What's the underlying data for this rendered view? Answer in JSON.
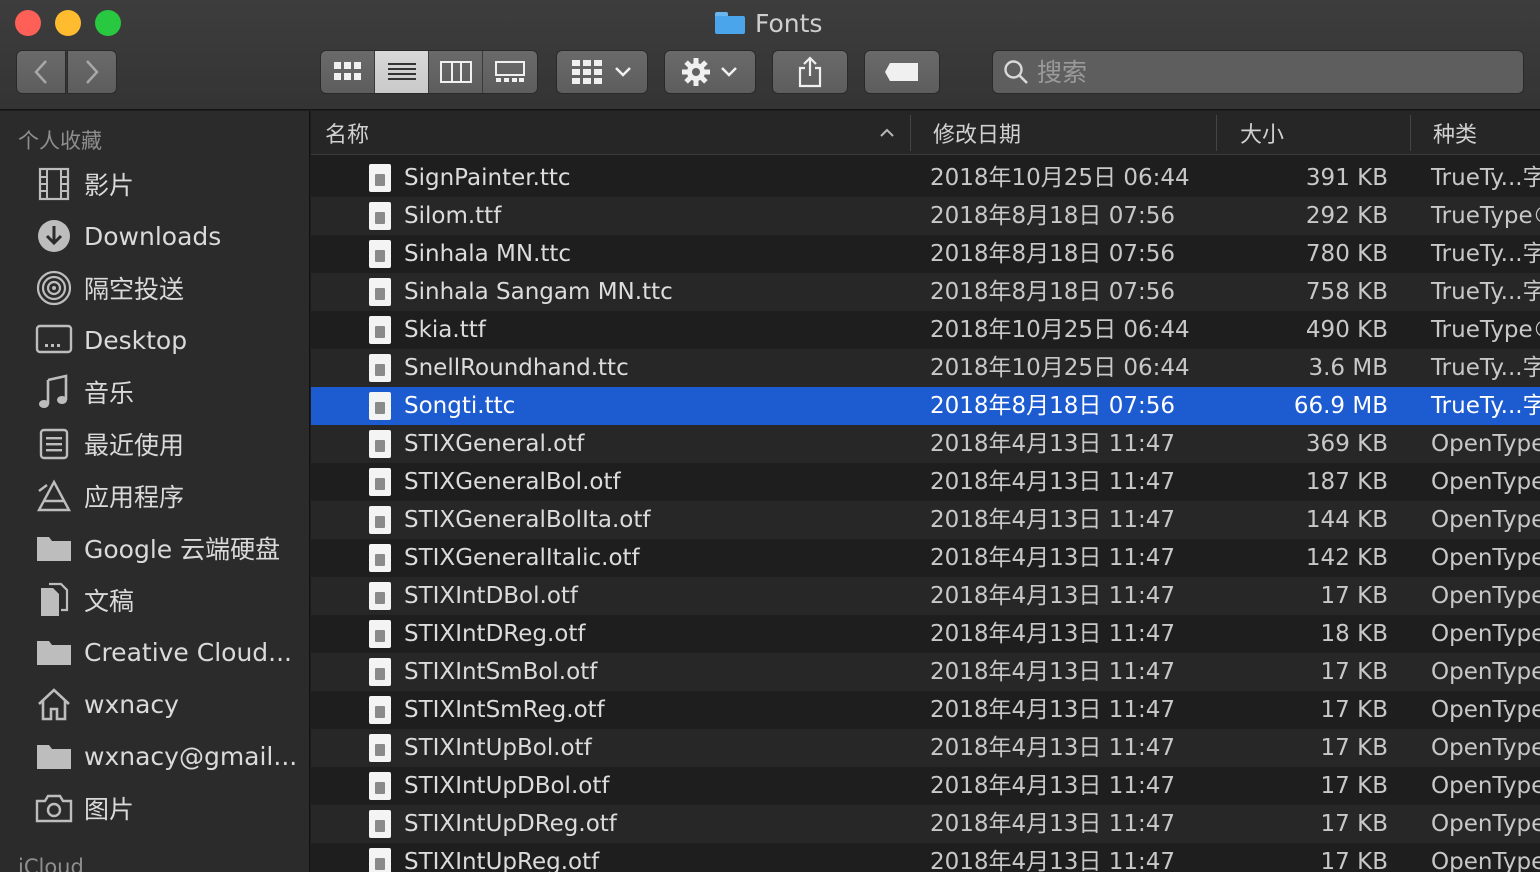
{
  "window": {
    "title": "Fonts"
  },
  "search": {
    "placeholder": "搜索"
  },
  "sidebar": {
    "sections": [
      {
        "label": "个人收藏"
      },
      {
        "label": "iCloud"
      }
    ],
    "items": [
      {
        "label": "影片",
        "icon": "film-icon"
      },
      {
        "label": "Downloads",
        "icon": "download-icon"
      },
      {
        "label": "隔空投送",
        "icon": "airdrop-icon"
      },
      {
        "label": "Desktop",
        "icon": "desktop-icon"
      },
      {
        "label": "音乐",
        "icon": "music-icon"
      },
      {
        "label": "最近使用",
        "icon": "recents-icon"
      },
      {
        "label": "应用程序",
        "icon": "applications-icon"
      },
      {
        "label": "Google 云端硬盘",
        "icon": "folder-icon"
      },
      {
        "label": "文稿",
        "icon": "documents-icon"
      },
      {
        "label": "Creative Cloud...",
        "icon": "folder-icon"
      },
      {
        "label": "wxnacy",
        "icon": "home-icon"
      },
      {
        "label": "wxnacy@gmail...",
        "icon": "folder-icon"
      },
      {
        "label": "图片",
        "icon": "camera-icon"
      }
    ]
  },
  "columns": {
    "name": "名称",
    "date": "修改日期",
    "size": "大小",
    "kind": "种类"
  },
  "files": [
    {
      "name": "SignPainter.ttc",
      "date": "2018年10月25日 06:44",
      "size": "391 KB",
      "kind": "TrueTy...字"
    },
    {
      "name": "Silom.ttf",
      "date": "2018年8月18日 07:56",
      "size": "292 KB",
      "kind": "TrueType®"
    },
    {
      "name": "Sinhala MN.ttc",
      "date": "2018年8月18日 07:56",
      "size": "780 KB",
      "kind": "TrueTy...字"
    },
    {
      "name": "Sinhala Sangam MN.ttc",
      "date": "2018年8月18日 07:56",
      "size": "758 KB",
      "kind": "TrueTy...字"
    },
    {
      "name": "Skia.ttf",
      "date": "2018年10月25日 06:44",
      "size": "490 KB",
      "kind": "TrueType®"
    },
    {
      "name": "SnellRoundhand.ttc",
      "date": "2018年10月25日 06:44",
      "size": "3.6 MB",
      "kind": "TrueTy...字"
    },
    {
      "name": "Songti.ttc",
      "date": "2018年8月18日 07:56",
      "size": "66.9 MB",
      "kind": "TrueTy...字",
      "selected": true
    },
    {
      "name": "STIXGeneral.otf",
      "date": "2018年4月13日 11:47",
      "size": "369 KB",
      "kind": "OpenType"
    },
    {
      "name": "STIXGeneralBol.otf",
      "date": "2018年4月13日 11:47",
      "size": "187 KB",
      "kind": "OpenType"
    },
    {
      "name": "STIXGeneralBolIta.otf",
      "date": "2018年4月13日 11:47",
      "size": "144 KB",
      "kind": "OpenType"
    },
    {
      "name": "STIXGeneralItalic.otf",
      "date": "2018年4月13日 11:47",
      "size": "142 KB",
      "kind": "OpenType"
    },
    {
      "name": "STIXIntDBol.otf",
      "date": "2018年4月13日 11:47",
      "size": "17 KB",
      "kind": "OpenType"
    },
    {
      "name": "STIXIntDReg.otf",
      "date": "2018年4月13日 11:47",
      "size": "18 KB",
      "kind": "OpenType"
    },
    {
      "name": "STIXIntSmBol.otf",
      "date": "2018年4月13日 11:47",
      "size": "17 KB",
      "kind": "OpenType"
    },
    {
      "name": "STIXIntSmReg.otf",
      "date": "2018年4月13日 11:47",
      "size": "17 KB",
      "kind": "OpenType"
    },
    {
      "name": "STIXIntUpBol.otf",
      "date": "2018年4月13日 11:47",
      "size": "17 KB",
      "kind": "OpenType"
    },
    {
      "name": "STIXIntUpDBol.otf",
      "date": "2018年4月13日 11:47",
      "size": "17 KB",
      "kind": "OpenType"
    },
    {
      "name": "STIXIntUpDReg.otf",
      "date": "2018年4月13日 11:47",
      "size": "17 KB",
      "kind": "OpenType"
    },
    {
      "name": "STIXIntUpReg.otf",
      "date": "2018年4月13日 11:47",
      "size": "17 KB",
      "kind": "OpenType"
    }
  ],
  "colors": {
    "selection": "#1d5bd1",
    "close": "#fe5f57",
    "minimize": "#febc2e",
    "maximize": "#28c840",
    "folder": "#4aa5ea"
  }
}
